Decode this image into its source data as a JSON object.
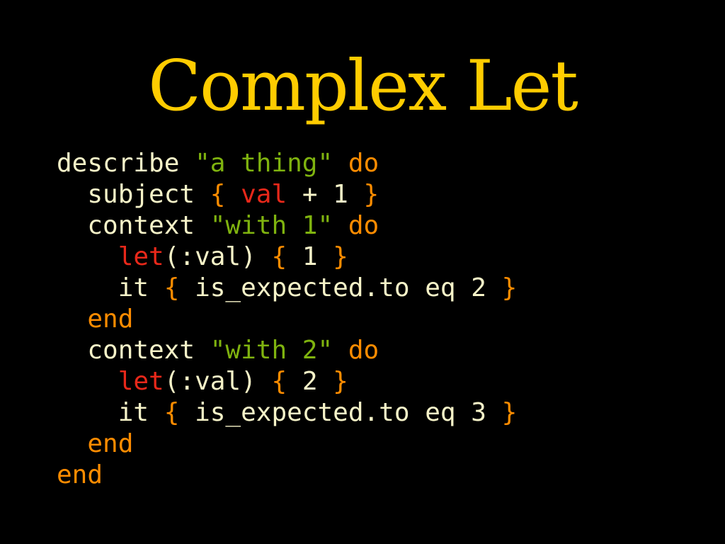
{
  "slide": {
    "title": "Complex Let"
  },
  "colors": {
    "background": "#000000",
    "title": "#FFCC00",
    "plain": "#F6F3C8",
    "string": "#7FB30F",
    "keyword": "#FF8C00",
    "special": "#E8281A"
  },
  "code": {
    "language": "ruby",
    "lines": [
      [
        {
          "t": "describe ",
          "c": "plain"
        },
        {
          "t": "\"a thing\"",
          "c": "string"
        },
        {
          "t": " ",
          "c": "plain"
        },
        {
          "t": "do",
          "c": "keyword"
        }
      ],
      [
        {
          "t": "  subject ",
          "c": "plain"
        },
        {
          "t": "{",
          "c": "keyword"
        },
        {
          "t": " ",
          "c": "plain"
        },
        {
          "t": "val",
          "c": "special"
        },
        {
          "t": " + 1 ",
          "c": "plain"
        },
        {
          "t": "}",
          "c": "keyword"
        }
      ],
      [
        {
          "t": "  context ",
          "c": "plain"
        },
        {
          "t": "\"with 1\"",
          "c": "string"
        },
        {
          "t": " ",
          "c": "plain"
        },
        {
          "t": "do",
          "c": "keyword"
        }
      ],
      [
        {
          "t": "    ",
          "c": "plain"
        },
        {
          "t": "let",
          "c": "special"
        },
        {
          "t": "(:val) ",
          "c": "plain"
        },
        {
          "t": "{",
          "c": "keyword"
        },
        {
          "t": " 1 ",
          "c": "plain"
        },
        {
          "t": "}",
          "c": "keyword"
        }
      ],
      [
        {
          "t": "    it ",
          "c": "plain"
        },
        {
          "t": "{",
          "c": "keyword"
        },
        {
          "t": " is_expected.to eq 2 ",
          "c": "plain"
        },
        {
          "t": "}",
          "c": "keyword"
        }
      ],
      [
        {
          "t": "  ",
          "c": "plain"
        },
        {
          "t": "end",
          "c": "keyword"
        }
      ],
      [
        {
          "t": "  context ",
          "c": "plain"
        },
        {
          "t": "\"with 2\"",
          "c": "string"
        },
        {
          "t": " ",
          "c": "plain"
        },
        {
          "t": "do",
          "c": "keyword"
        }
      ],
      [
        {
          "t": "    ",
          "c": "plain"
        },
        {
          "t": "let",
          "c": "special"
        },
        {
          "t": "(:val) ",
          "c": "plain"
        },
        {
          "t": "{",
          "c": "keyword"
        },
        {
          "t": " 2 ",
          "c": "plain"
        },
        {
          "t": "}",
          "c": "keyword"
        }
      ],
      [
        {
          "t": "    it ",
          "c": "plain"
        },
        {
          "t": "{",
          "c": "keyword"
        },
        {
          "t": " is_expected.to eq 3 ",
          "c": "plain"
        },
        {
          "t": "}",
          "c": "keyword"
        }
      ],
      [
        {
          "t": "  ",
          "c": "plain"
        },
        {
          "t": "end",
          "c": "keyword"
        }
      ],
      [
        {
          "t": "end",
          "c": "keyword"
        }
      ]
    ]
  }
}
